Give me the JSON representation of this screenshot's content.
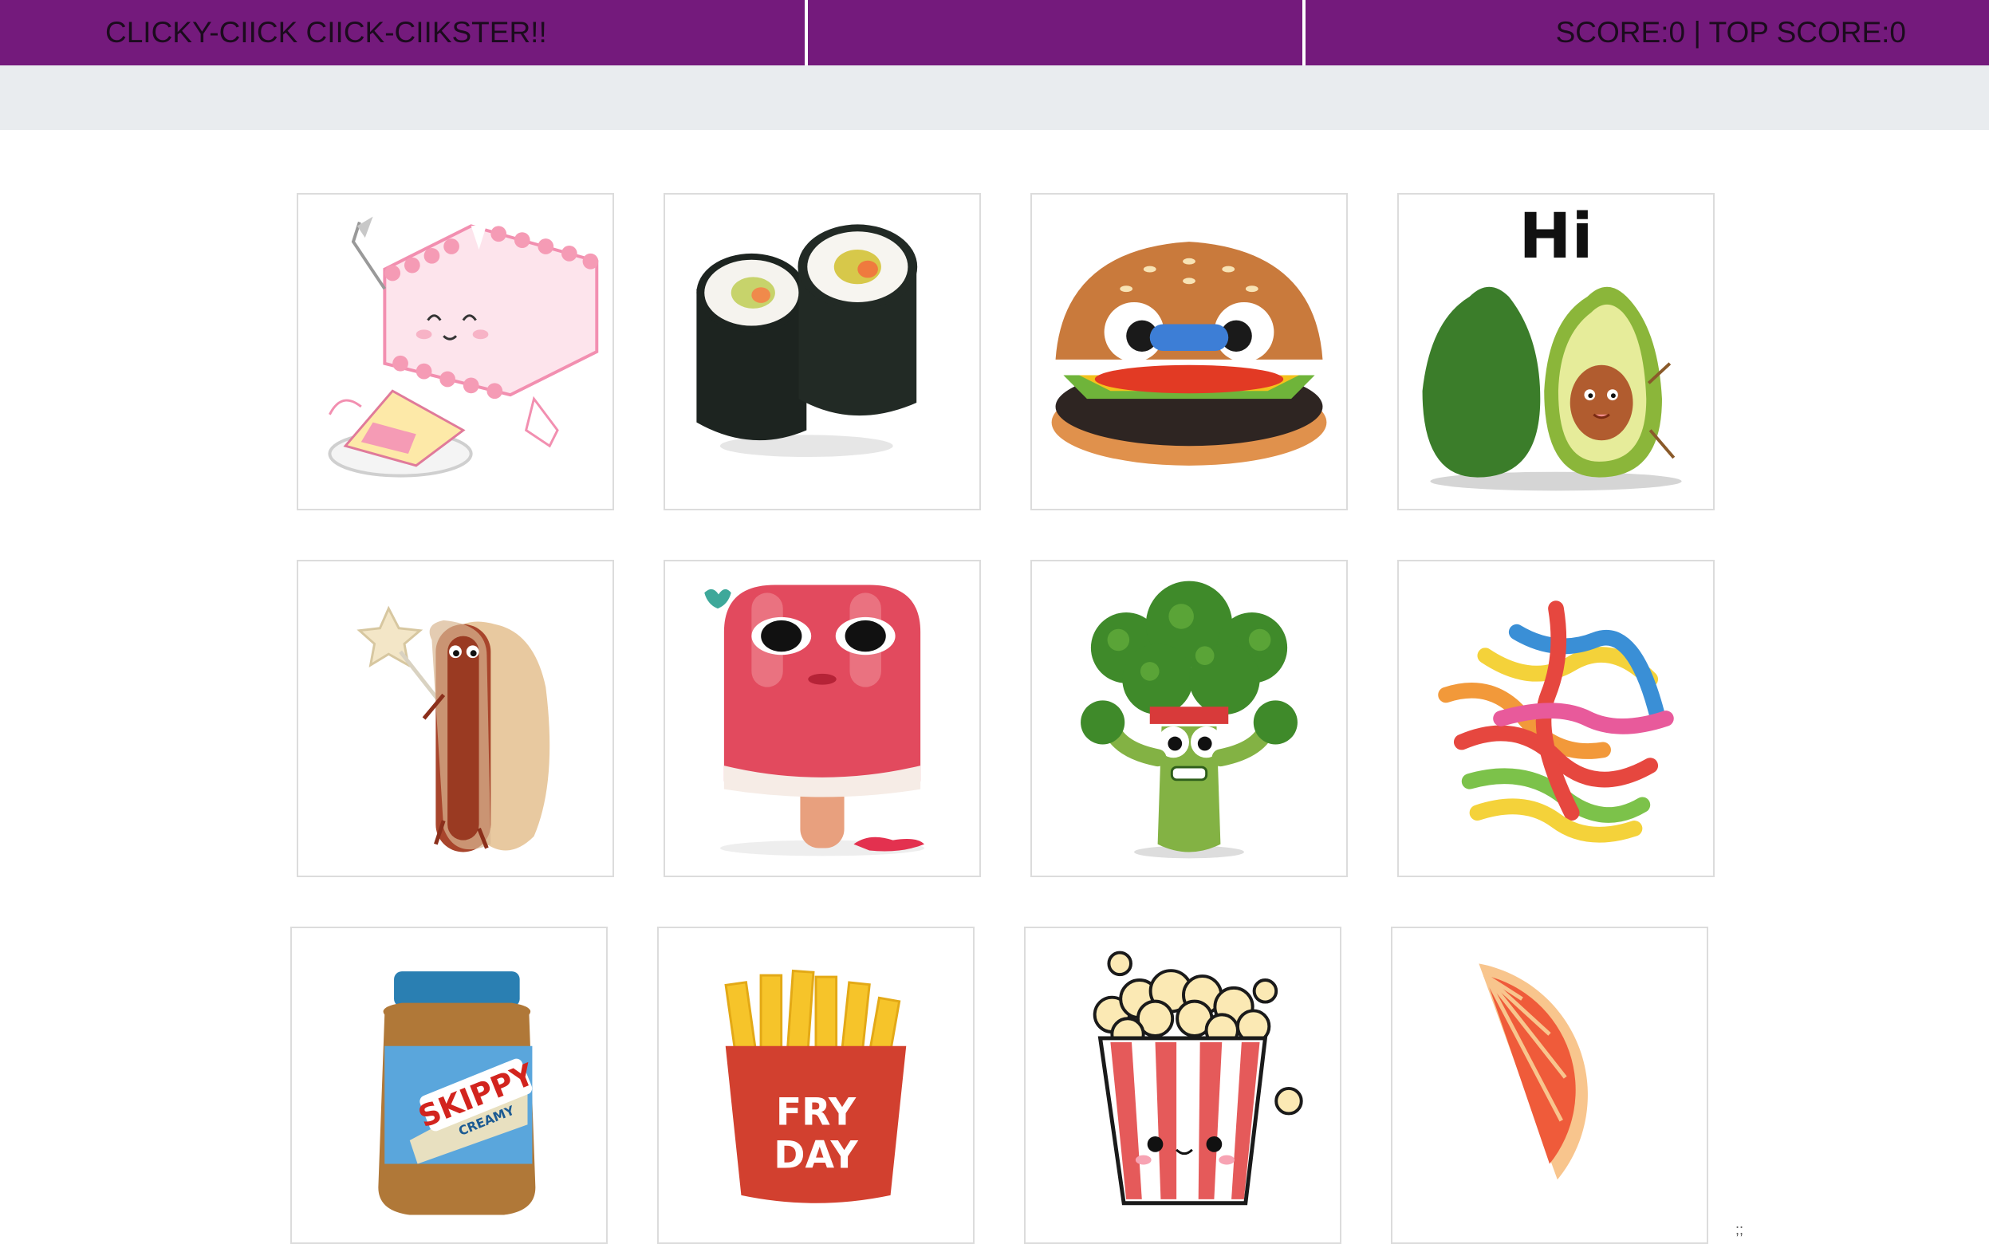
{
  "header": {
    "title": "CLICKY-CIICK CIICK-CIIKSTER!!",
    "score_text": "SCORE:0 | TOP SCORE:0"
  },
  "colors": {
    "nav_bg": "#741a7c",
    "subbar_bg": "#e9ecef",
    "card_border": "#dcdcdc"
  },
  "cards": [
    {
      "name": "cake",
      "icon": "cake-icon"
    },
    {
      "name": "sushi",
      "icon": "sushi-icon"
    },
    {
      "name": "burger",
      "icon": "burger-icon"
    },
    {
      "name": "avocado",
      "icon": "avocado-icon",
      "caption": "Hi"
    },
    {
      "name": "hotdog",
      "icon": "hotdog-icon"
    },
    {
      "name": "popsicle",
      "icon": "popsicle-icon"
    },
    {
      "name": "broccoli",
      "icon": "broccoli-icon"
    },
    {
      "name": "gummy-worms",
      "icon": "gummy-worms-icon"
    },
    {
      "name": "peanut-butter",
      "icon": "peanut-butter-icon",
      "brand": "SKIPPY",
      "variant": "CREAMY"
    },
    {
      "name": "fries",
      "icon": "fries-icon",
      "line1": "FRY",
      "line2": "DAY"
    },
    {
      "name": "popcorn",
      "icon": "popcorn-icon"
    },
    {
      "name": "grapefruit",
      "icon": "grapefruit-icon"
    }
  ],
  "footer_mark": ";;"
}
